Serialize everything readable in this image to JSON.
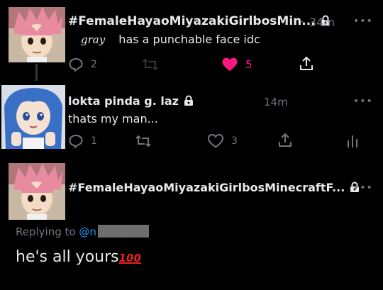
{
  "tweets": [
    {
      "display_name": "#FemaleHayaoMiyazakiGirlbosMin...",
      "separator": "·",
      "time": "34m",
      "handwritten_name": "gray",
      "text": "has a punchable face idc",
      "reply_count": "2",
      "like_count": "5"
    },
    {
      "display_name": "lokta pinda g. laz",
      "time": "14m",
      "text": "thats my man...",
      "reply_count": "1",
      "like_count": "3"
    },
    {
      "display_name": "#FemaleHayaoMiyazakiGirlbosMinecraftF...",
      "replying_label": "Replying to",
      "replying_handle": "@n",
      "text": "he's all yours",
      "emoji": "100"
    }
  ],
  "colors": {
    "background": "#000000",
    "text": "#e7e9ea",
    "muted": "#71767b",
    "like": "#f91880",
    "link": "#1d9bf0"
  },
  "icons": [
    "reply-icon",
    "retweet-icon",
    "heart-filled-icon",
    "heart-icon",
    "share-icon",
    "views-icon",
    "lock-icon",
    "more-icon"
  ]
}
